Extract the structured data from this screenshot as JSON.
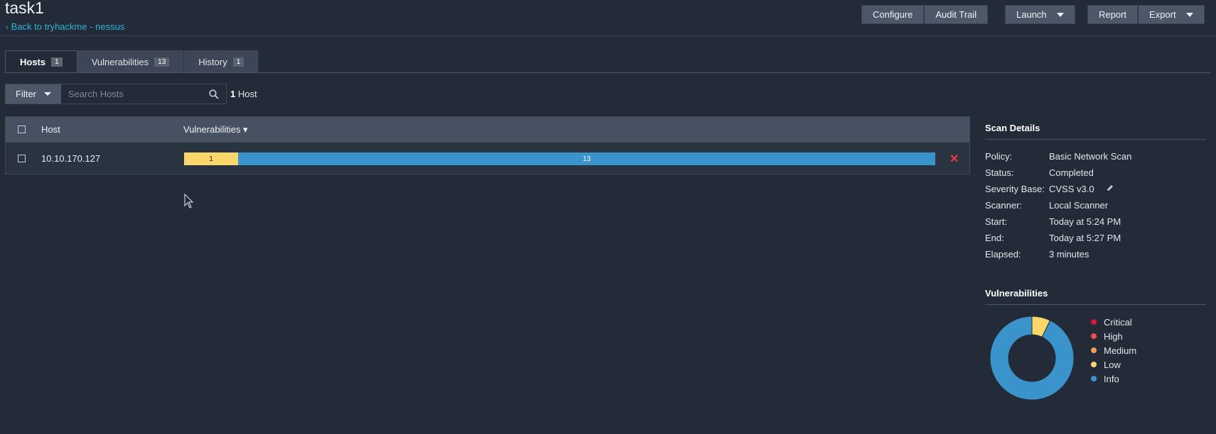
{
  "header": {
    "title": "task1",
    "back_link": "Back to tryhackme - nessus",
    "buttons": {
      "configure": "Configure",
      "audit_trail": "Audit Trail",
      "launch": "Launch",
      "report": "Report",
      "export": "Export"
    }
  },
  "tabs": [
    {
      "label": "Hosts",
      "count": "1",
      "active": true
    },
    {
      "label": "Vulnerabilities",
      "count": "13",
      "active": false
    },
    {
      "label": "History",
      "count": "1",
      "active": false
    }
  ],
  "filter": {
    "label": "Filter",
    "search_placeholder": "Search Hosts",
    "count_number": "1",
    "count_text": "Host"
  },
  "table": {
    "headers": {
      "host": "Host",
      "vulnerabilities": "Vulnerabilities ▾"
    },
    "rows": [
      {
        "host": "10.10.170.127",
        "low": "1",
        "info": "13"
      }
    ]
  },
  "scan_details": {
    "title": "Scan Details",
    "items": [
      {
        "key": "Policy:",
        "value": "Basic Network Scan"
      },
      {
        "key": "Status:",
        "value": "Completed"
      },
      {
        "key": "Severity Base:",
        "value": "CVSS v3.0"
      },
      {
        "key": "Scanner:",
        "value": "Local Scanner"
      },
      {
        "key": "Start:",
        "value": "Today at 5:24 PM"
      },
      {
        "key": "End:",
        "value": "Today at 5:27 PM"
      },
      {
        "key": "Elapsed:",
        "value": "3 minutes"
      }
    ]
  },
  "vulnerabilities_panel": {
    "title": "Vulnerabilities",
    "legend": [
      {
        "label": "Critical",
        "color": "#d4193a"
      },
      {
        "label": "High",
        "color": "#ee4c58"
      },
      {
        "label": "Medium",
        "color": "#fd9a5b"
      },
      {
        "label": "Low",
        "color": "#fbd66a"
      },
      {
        "label": "Info",
        "color": "#3a94cb"
      }
    ]
  },
  "chart_data": {
    "type": "pie",
    "categories": [
      "Critical",
      "High",
      "Medium",
      "Low",
      "Info"
    ],
    "values": [
      0,
      0,
      0,
      1,
      13
    ],
    "colors": [
      "#d4193a",
      "#ee4c58",
      "#fd9a5b",
      "#fbd66a",
      "#3a94cb"
    ]
  }
}
